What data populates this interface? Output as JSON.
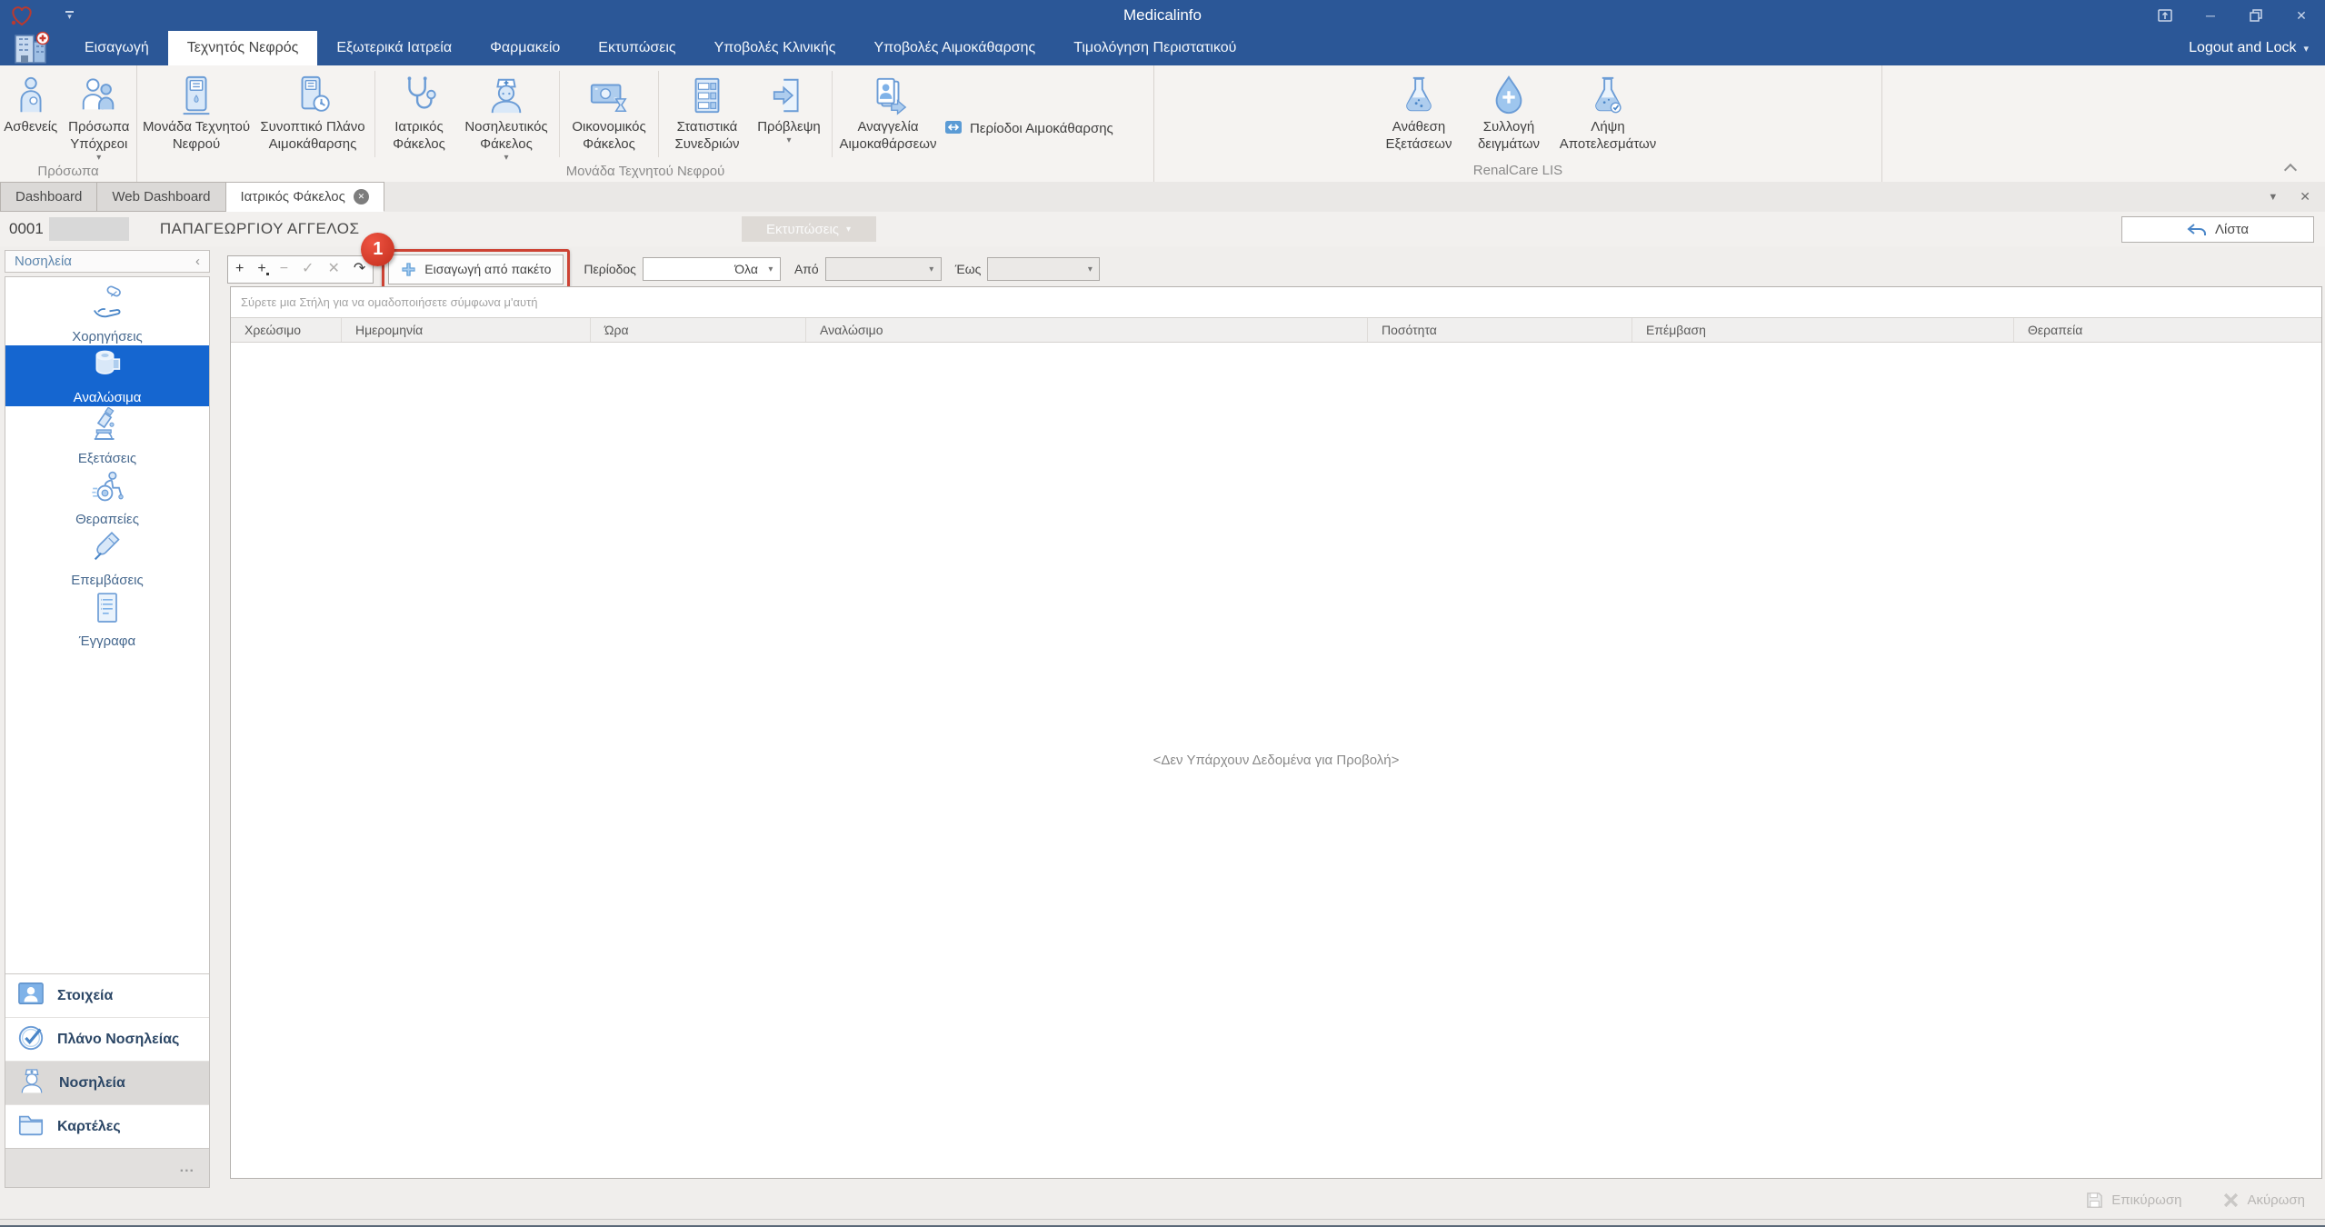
{
  "colors": {
    "titlebar_blue": "#2b5797",
    "active_item_blue": "#1566d0",
    "highlight_red": "#cd4334"
  },
  "icons": {
    "dropdown": "▾",
    "tab_list_arrow": "▼",
    "close": "✕",
    "collapse_left": "‹",
    "minimize": "─",
    "plus": "+",
    "minus": "−",
    "check": "✓",
    "redo": "↷",
    "overflow": "..."
  },
  "titlebar": {
    "title": "Medicalinfo"
  },
  "ribbon": {
    "logout_label": "Logout and Lock",
    "tabs": [
      {
        "label": "Εισαγωγή"
      },
      {
        "label": "Τεχνητός Νεφρός"
      },
      {
        "label": "Εξωτερικά Ιατρεία"
      },
      {
        "label": "Φαρμακείο"
      },
      {
        "label": "Εκτυπώσεις"
      },
      {
        "label": "Υποβολές Κλινικής"
      },
      {
        "label": "Υποβολές Αιμοκάθαρσης"
      },
      {
        "label": "Τιμολόγηση Περιστατικού"
      }
    ],
    "groups": [
      {
        "label": "Πρόσωπα",
        "buttons": [
          {
            "label": "Ασθενείς",
            "icon": "patient-icon"
          },
          {
            "label": "Πρόσωπα Υπόχρεοι",
            "icon": "people-icon"
          }
        ]
      },
      {
        "label": "Μονάδα Τεχνητού Νεφρού",
        "buttons": [
          {
            "label": "Μονάδα Τεχνητού Νεφρού",
            "icon": "dialysis-machine-icon"
          },
          {
            "label": "Συνοπτικό Πλάνο Αιμοκάθαρσης",
            "icon": "dialysis-plan-icon"
          },
          {
            "label": "Ιατρικός Φάκελος",
            "icon": "stethoscope-icon"
          },
          {
            "label": "Νοσηλευτικός Φάκελος",
            "icon": "nurse-icon"
          },
          {
            "label": "Οικονομικός Φάκελος",
            "icon": "money-icon"
          },
          {
            "label": "Στατιστικά Συνεδριών",
            "icon": "statistics-icon"
          },
          {
            "label": "Πρόβλεψη",
            "icon": "forecast-icon"
          },
          {
            "label": "Αναγγελία Αιμοκαθάρσεων",
            "icon": "announcement-icon"
          },
          {
            "label": "Περίοδοι Αιμοκάθαρσης",
            "icon": "periods-icon"
          }
        ]
      },
      {
        "label": "RenalCare LIS",
        "buttons": [
          {
            "label": "Ανάθεση Εξετάσεων",
            "icon": "flask-icon"
          },
          {
            "label": "Συλλογή δειγμάτων",
            "icon": "drop-plus-icon"
          },
          {
            "label": "Λήψη Αποτελεσμάτων",
            "icon": "flask-result-icon"
          }
        ]
      }
    ]
  },
  "tabstrip": {
    "tabs": [
      {
        "label": "Dashboard"
      },
      {
        "label": "Web Dashboard"
      },
      {
        "label": "Ιατρικός Φάκελος"
      }
    ]
  },
  "patient": {
    "code": "0001",
    "name": "ΠΑΠΑΓΕΩΡΓΙΟΥ ΑΓΓΕΛΟΣ",
    "print_button": "Εκτυπώσεις",
    "list_button": "Λίστα"
  },
  "sidebar": {
    "header": "Νοσηλεία",
    "items": [
      {
        "label": "Χορηγήσεις",
        "icon": "hand-pill-icon"
      },
      {
        "label": "Αναλώσιμα",
        "icon": "gauze-roll-icon"
      },
      {
        "label": "Εξετάσεις",
        "icon": "microscope-icon"
      },
      {
        "label": "Θεραπείες",
        "icon": "wheelchair-icon"
      },
      {
        "label": "Επεμβάσεις",
        "icon": "scalpel-icon"
      },
      {
        "label": "Έγγραφα",
        "icon": "document-icon"
      }
    ],
    "sections": [
      {
        "label": "Στοιχεία",
        "icon": "id-card-icon"
      },
      {
        "label": "Πλάνο Νοσηλείας",
        "icon": "check-circle-icon"
      },
      {
        "label": "Νοσηλεία",
        "icon": "nurse-icon"
      },
      {
        "label": "Καρτέλες",
        "icon": "folder-icon"
      }
    ]
  },
  "toolbar": {
    "import_button": "Εισαγωγή από πακέτο",
    "badge": "1",
    "period_label": "Περίοδος",
    "period_value": "Όλα",
    "from_label": "Από",
    "to_label": "Έως"
  },
  "grid": {
    "group_hint": "Σύρετε μια Στήλη για να ομαδοποιήσετε σύμφωνα μ'αυτή",
    "columns": [
      "Χρεώσιμο",
      "Ημερομηνία",
      "Ώρα",
      "Αναλώσιμο",
      "Ποσότητα",
      "Επέμβαση",
      "Θεραπεία"
    ],
    "empty_message": "<Δεν Υπάρχουν Δεδομένα για Προβολή>"
  },
  "footer": {
    "confirm": "Επικύρωση",
    "cancel": "Ακύρωση"
  }
}
